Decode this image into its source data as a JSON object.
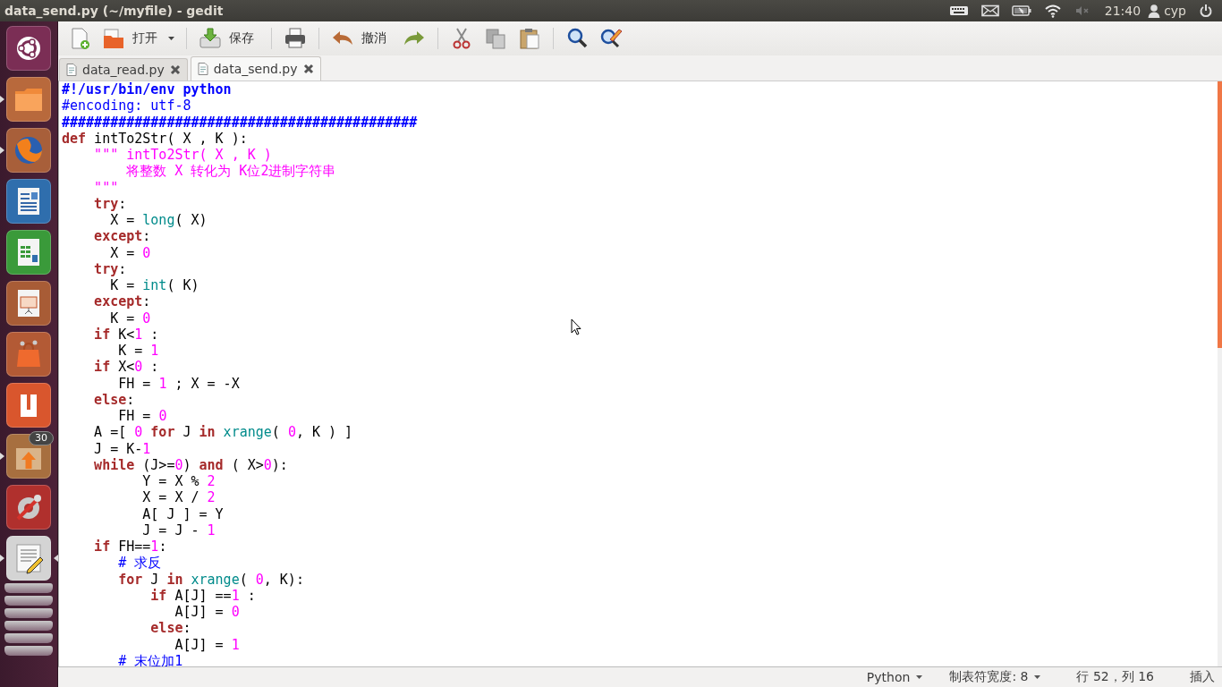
{
  "window": {
    "title": "data_send.py (~/myfile) - gedit"
  },
  "panel": {
    "indicators": [
      {
        "kind": "keyboard"
      },
      {
        "kind": "mail"
      },
      {
        "kind": "battery"
      },
      {
        "kind": "wifi"
      },
      {
        "kind": "volume-muted"
      }
    ],
    "time": "21:40",
    "user": "cyp"
  },
  "launcher": [
    {
      "kind": "ubuntu",
      "running": false,
      "focused": false
    },
    {
      "kind": "folder",
      "running": true,
      "focused": false
    },
    {
      "kind": "browser",
      "running": true,
      "focused": false
    },
    {
      "kind": "writer",
      "running": false,
      "focused": false
    },
    {
      "kind": "calc",
      "running": false,
      "focused": false
    },
    {
      "kind": "impress",
      "running": false,
      "focused": false
    },
    {
      "kind": "bag",
      "running": false,
      "focused": false
    },
    {
      "kind": "u-app",
      "running": false,
      "focused": false
    },
    {
      "kind": "update",
      "running": true,
      "focused": false,
      "badge": "30"
    },
    {
      "kind": "settings",
      "running": false,
      "focused": false
    },
    {
      "kind": "editor",
      "running": true,
      "focused": true
    }
  ],
  "toolbar": [
    [
      {
        "kind": "new"
      },
      {
        "kind": "open",
        "label": "打开"
      },
      {
        "kind": "dropdown"
      }
    ],
    [
      {
        "kind": "save",
        "label": "保存"
      }
    ],
    [
      {
        "kind": "print"
      }
    ],
    [
      {
        "kind": "undo",
        "label": "撤消"
      },
      {
        "kind": "redo"
      }
    ],
    [
      {
        "kind": "cut"
      },
      {
        "kind": "copy"
      },
      {
        "kind": "paste"
      }
    ],
    [
      {
        "kind": "search"
      },
      {
        "kind": "replace"
      }
    ]
  ],
  "tabs": [
    {
      "label": "data_read.py",
      "selected": false
    },
    {
      "label": "data_send.py",
      "selected": true
    }
  ],
  "code": [
    [
      {
        "kind": "heading",
        "text": "#!/usr/bin/env python"
      }
    ],
    [
      {
        "kind": "comment",
        "text": "#encoding: utf-8"
      }
    ],
    [
      {
        "kind": "heading",
        "text": "############################################"
      }
    ],
    [
      {
        "kind": "keyword",
        "text": "def"
      },
      {
        "kind": "plain",
        "text": " intTo2Str( X , K ):"
      }
    ],
    [
      {
        "kind": "string",
        "text": "    \"\"\" intTo2Str( X , K )"
      }
    ],
    [
      {
        "kind": "string",
        "text": "        将整数 X 转化为 K位2进制字符串"
      }
    ],
    [
      {
        "kind": "string",
        "text": "    \"\"\""
      }
    ],
    [
      {
        "kind": "keyword",
        "text": "    try"
      },
      {
        "kind": "plain",
        "text": ":"
      }
    ],
    [
      {
        "kind": "plain",
        "text": "      X = "
      },
      {
        "kind": "builtin",
        "text": "long"
      },
      {
        "kind": "plain",
        "text": "( X)"
      }
    ],
    [
      {
        "kind": "keyword",
        "text": "    except"
      },
      {
        "kind": "plain",
        "text": ":"
      }
    ],
    [
      {
        "kind": "plain",
        "text": "      X = "
      },
      {
        "kind": "number",
        "text": "0"
      }
    ],
    [
      {
        "kind": "keyword",
        "text": "    try"
      },
      {
        "kind": "plain",
        "text": ":"
      }
    ],
    [
      {
        "kind": "plain",
        "text": "      K = "
      },
      {
        "kind": "builtin",
        "text": "int"
      },
      {
        "kind": "plain",
        "text": "( K)"
      }
    ],
    [
      {
        "kind": "keyword",
        "text": "    except"
      },
      {
        "kind": "plain",
        "text": ":"
      }
    ],
    [
      {
        "kind": "plain",
        "text": "      K = "
      },
      {
        "kind": "number",
        "text": "0"
      }
    ],
    [
      {
        "kind": "keyword",
        "text": "    if"
      },
      {
        "kind": "plain",
        "text": " K<"
      },
      {
        "kind": "number",
        "text": "1"
      },
      {
        "kind": "plain",
        "text": " :"
      }
    ],
    [
      {
        "kind": "plain",
        "text": "       K = "
      },
      {
        "kind": "number",
        "text": "1"
      }
    ],
    [
      {
        "kind": "keyword",
        "text": "    if"
      },
      {
        "kind": "plain",
        "text": " X<"
      },
      {
        "kind": "number",
        "text": "0"
      },
      {
        "kind": "plain",
        "text": " :"
      }
    ],
    [
      {
        "kind": "plain",
        "text": "       FH = "
      },
      {
        "kind": "number",
        "text": "1"
      },
      {
        "kind": "plain",
        "text": " ; X = -X"
      }
    ],
    [
      {
        "kind": "keyword",
        "text": "    else"
      },
      {
        "kind": "plain",
        "text": ":"
      }
    ],
    [
      {
        "kind": "plain",
        "text": "       FH = "
      },
      {
        "kind": "number",
        "text": "0"
      }
    ],
    [
      {
        "kind": "plain",
        "text": "    A =[ "
      },
      {
        "kind": "number",
        "text": "0"
      },
      {
        "kind": "keyword",
        "text": " for"
      },
      {
        "kind": "plain",
        "text": " J "
      },
      {
        "kind": "keyword",
        "text": "in"
      },
      {
        "kind": "builtin",
        "text": " xrange"
      },
      {
        "kind": "plain",
        "text": "( "
      },
      {
        "kind": "number",
        "text": "0"
      },
      {
        "kind": "plain",
        "text": ", K ) ]"
      }
    ],
    [
      {
        "kind": "plain",
        "text": "    J = K-"
      },
      {
        "kind": "number",
        "text": "1"
      }
    ],
    [
      {
        "kind": "keyword",
        "text": "    while"
      },
      {
        "kind": "plain",
        "text": " (J>="
      },
      {
        "kind": "number",
        "text": "0"
      },
      {
        "kind": "plain",
        "text": ") "
      },
      {
        "kind": "keyword",
        "text": "and"
      },
      {
        "kind": "plain",
        "text": " ( X>"
      },
      {
        "kind": "number",
        "text": "0"
      },
      {
        "kind": "plain",
        "text": "):"
      }
    ],
    [
      {
        "kind": "plain",
        "text": "          Y = X % "
      },
      {
        "kind": "number",
        "text": "2"
      }
    ],
    [
      {
        "kind": "plain",
        "text": "          X = X / "
      },
      {
        "kind": "number",
        "text": "2"
      }
    ],
    [
      {
        "kind": "plain",
        "text": "          A[ J ] = Y"
      }
    ],
    [
      {
        "kind": "plain",
        "text": "          J = J - "
      },
      {
        "kind": "number",
        "text": "1"
      }
    ],
    [
      {
        "kind": "keyword",
        "text": "    if"
      },
      {
        "kind": "plain",
        "text": " FH=="
      },
      {
        "kind": "number",
        "text": "1"
      },
      {
        "kind": "plain",
        "text": ":"
      }
    ],
    [
      {
        "kind": "comment",
        "text": "       # 求反"
      }
    ],
    [
      {
        "kind": "keyword",
        "text": "       for"
      },
      {
        "kind": "plain",
        "text": " J "
      },
      {
        "kind": "keyword",
        "text": "in"
      },
      {
        "kind": "builtin",
        "text": " xrange"
      },
      {
        "kind": "plain",
        "text": "( "
      },
      {
        "kind": "number",
        "text": "0"
      },
      {
        "kind": "plain",
        "text": ", K):"
      }
    ],
    [
      {
        "kind": "keyword",
        "text": "           if"
      },
      {
        "kind": "plain",
        "text": " A[J] =="
      },
      {
        "kind": "number",
        "text": "1"
      },
      {
        "kind": "plain",
        "text": " :"
      }
    ],
    [
      {
        "kind": "plain",
        "text": "              A[J] = "
      },
      {
        "kind": "number",
        "text": "0"
      }
    ],
    [
      {
        "kind": "keyword",
        "text": "           else"
      },
      {
        "kind": "plain",
        "text": ":"
      }
    ],
    [
      {
        "kind": "plain",
        "text": "              A[J] = "
      },
      {
        "kind": "number",
        "text": "1"
      }
    ],
    [
      {
        "kind": "comment",
        "text": "       # 末位加1"
      }
    ]
  ],
  "status_bar": [
    {
      "kind": "dropdown",
      "label": "Python"
    },
    {
      "kind": "dropdown",
      "label": "制表符宽度: 8"
    },
    {
      "kind": "text",
      "label": "行 52，列 16"
    },
    {
      "kind": "text",
      "label": "插入"
    }
  ]
}
